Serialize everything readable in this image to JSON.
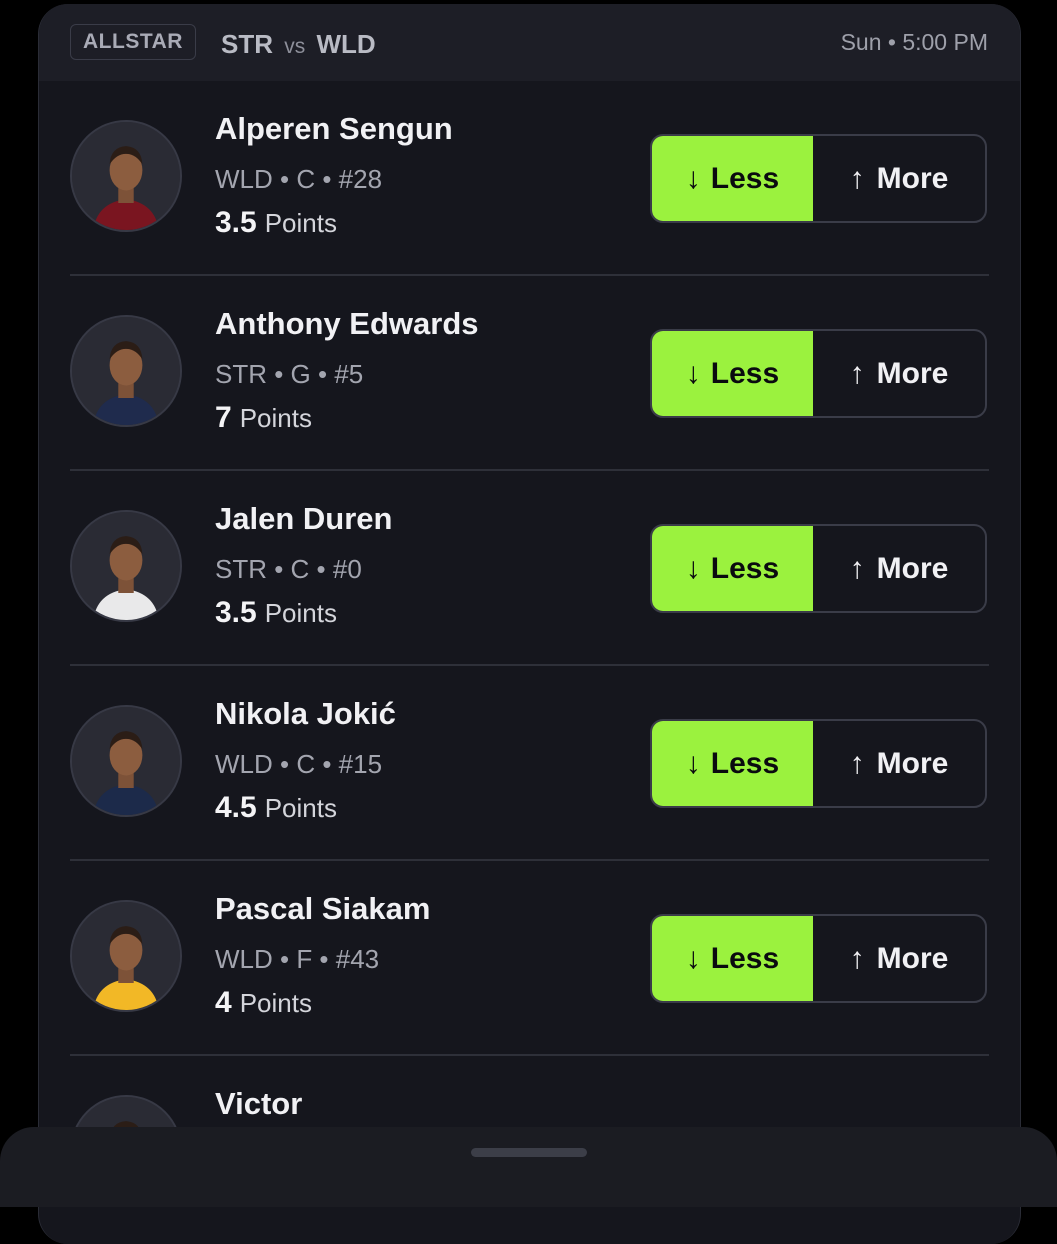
{
  "header": {
    "league": "ALLSTAR",
    "team_home": "STR",
    "vs": "vs",
    "team_away": "WLD",
    "game_time": "Sun • 5:00 PM"
  },
  "buttons": {
    "less": "Less",
    "more": "More"
  },
  "players": [
    {
      "name": "Alperen Sengun",
      "meta": "WLD • C • #28",
      "line": "3.5",
      "stat": "Points",
      "jersey_color": "#7a1520"
    },
    {
      "name": "Anthony Edwards",
      "meta": "STR • G • #5",
      "line": "7",
      "stat": "Points",
      "jersey_color": "#1f2b4d"
    },
    {
      "name": "Jalen Duren",
      "meta": "STR • C • #0",
      "line": "3.5",
      "stat": "Points",
      "jersey_color": "#e9e9ea"
    },
    {
      "name": "Nikola Jokić",
      "meta": "WLD • C • #15",
      "line": "4.5",
      "stat": "Points",
      "jersey_color": "#1c2a4a"
    },
    {
      "name": "Pascal Siakam",
      "meta": "WLD • F • #43",
      "line": "4",
      "stat": "Points",
      "jersey_color": "#f2b826"
    },
    {
      "name": "Victor",
      "meta": "",
      "line": "",
      "stat": "",
      "jersey_color": "#1f2b4d"
    }
  ],
  "colors": {
    "accent": "#9bf23e",
    "background": "#15161d"
  }
}
